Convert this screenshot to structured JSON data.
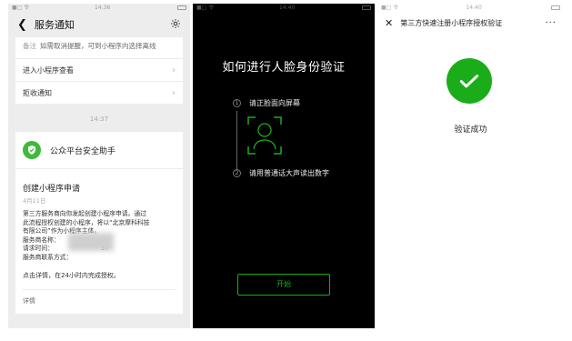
{
  "panel1": {
    "status": {
      "left": "■□ 令",
      "time": "14:36",
      "right": ""
    },
    "nav_title": "服务通知",
    "note_tag": "备注",
    "note_text": "如需取消提醒，可到小程序内选择离线",
    "rows": [
      {
        "label": "进入小程序查看"
      },
      {
        "label": "拒收通知"
      }
    ],
    "timestamp": "14:37",
    "card_sender": "公众平台安全助手",
    "card_title": "创建小程序申请",
    "card_date": "4月11日",
    "card_lines": [
      "第三方服务商向你发起创建小程序申请。通过",
      "此流程授权创建的小程序，将以“北京摩科科技",
      "有限公司”作为小程序主体。",
      "服务商名称：",
      "请求时间：",
      "服务商联系方式："
    ],
    "card_time_suffix": "37",
    "card_footer": "点击详情，在24小时内完成授权。",
    "card_detail": "详情"
  },
  "panel2": {
    "status": {
      "left": "■□ 令",
      "time": "14:40",
      "right": ""
    },
    "title": "如何进行人脸身份验证",
    "steps": [
      {
        "num": "1",
        "text": "请正脸面向屏幕"
      },
      {
        "num": "2",
        "text": "请用普通话大声读出数字"
      }
    ],
    "start_label": "开始"
  },
  "panel3": {
    "status": {
      "left": "■□ 令",
      "time": "14:40",
      "right": ""
    },
    "nav_title": "第三方快速注册小程序授权验证",
    "more_label": "···",
    "success_text": "验证成功"
  },
  "colors": {
    "accent_green": "#1aad19",
    "shield_green": "#3dba3a",
    "panel1_bg": "#ededed",
    "panel2_bg": "#000000"
  },
  "icons": [
    "back-chevron-icon",
    "gear-icon",
    "chevron-right-icon",
    "shield-check-icon",
    "face-scan-icon",
    "close-icon",
    "more-icon",
    "check-circle-icon"
  ]
}
